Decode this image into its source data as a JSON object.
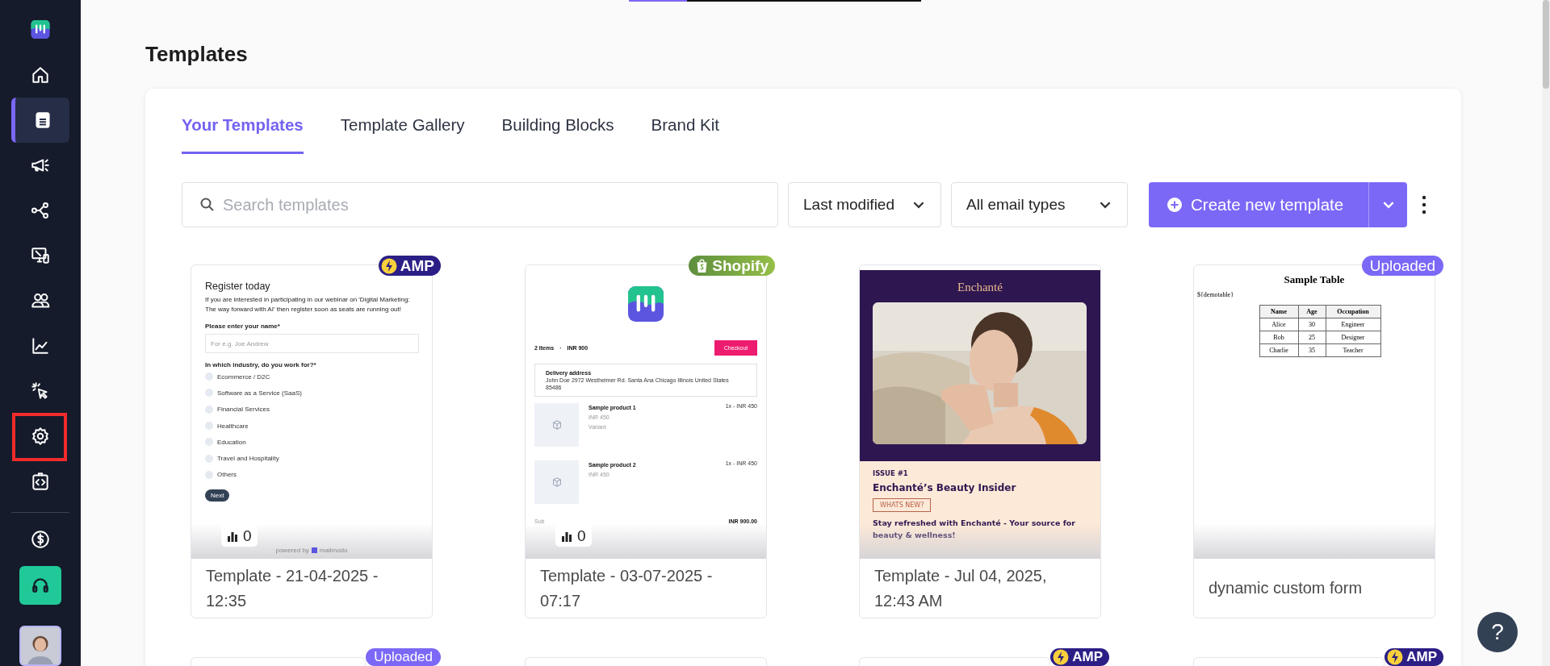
{
  "top_progress": {
    "level": 0.2
  },
  "sidebar": {
    "items": [
      {
        "kind": "home",
        "selected": false,
        "highlighted": false
      },
      {
        "kind": "templates",
        "selected": true,
        "highlighted": false
      },
      {
        "kind": "campaigns",
        "selected": false,
        "highlighted": false
      },
      {
        "kind": "journeys",
        "selected": false,
        "highlighted": false
      },
      {
        "kind": "devices",
        "selected": false,
        "highlighted": false
      },
      {
        "kind": "contacts",
        "selected": false,
        "highlighted": false
      },
      {
        "kind": "analytics",
        "selected": false,
        "highlighted": false
      },
      {
        "kind": "interactions",
        "selected": false,
        "highlighted": false
      },
      {
        "kind": "settings",
        "selected": false,
        "highlighted": true
      },
      {
        "kind": "code",
        "selected": false,
        "highlighted": false
      }
    ],
    "footer_items": [
      {
        "kind": "billing"
      },
      {
        "kind": "support"
      },
      {
        "kind": "profile"
      }
    ]
  },
  "page_title": "Templates",
  "tabs": [
    {
      "label": "Your Templates",
      "selected": true
    },
    {
      "label": "Template Gallery",
      "selected": false
    },
    {
      "label": "Building Blocks",
      "selected": false
    },
    {
      "label": "Brand Kit",
      "selected": false
    }
  ],
  "search": {
    "placeholder": "Search templates"
  },
  "filters": [
    {
      "label": "Last modified"
    },
    {
      "label": "All email types"
    }
  ],
  "create_button": {
    "label": "Create new template"
  },
  "templates": [
    {
      "badge": {
        "kind": "amp",
        "label": "AMP"
      },
      "stats": "0",
      "title": "Template - 21-04-2025 - 12:35",
      "preview": {
        "kind": "amp_form",
        "heading": "Register today",
        "intro": "If you are interested in participating in our webinar on 'Digital Marketing: The way forward with AI' then register soon as seats are running out!",
        "name_label": "Please enter your name*",
        "name_placeholder": "For e.g. Joe Andrew",
        "question": "In which industry, do you work for?*",
        "options": [
          {
            "label": "Ecommerce / D2C",
            "selected": false
          },
          {
            "label": "Software as a Service (SaaS)",
            "selected": false
          },
          {
            "label": "Financial Services",
            "selected": false
          },
          {
            "label": "Healthcare",
            "selected": false
          },
          {
            "label": "Education",
            "selected": false
          },
          {
            "label": "Travel and Hospitality",
            "selected": false
          },
          {
            "label": "Others",
            "selected": false
          }
        ],
        "button": "Next",
        "footer": "powered by",
        "footer_brand": "mailmodo"
      }
    },
    {
      "badge": {
        "kind": "shopify",
        "label": "Shopify"
      },
      "stats": "0",
      "title": "Template - 03-07-2025 - 07:17",
      "preview": {
        "kind": "shopify_cart",
        "count": "2 Items",
        "separator": "·",
        "total": "INR 900",
        "checkout": "Checkout",
        "address_label": "Delivery address",
        "address": "John Doe 2972 Westheimer Rd. Santa Ana Chicago Illinois United States 85486",
        "products": [
          {
            "name": "Sample product 1",
            "price": "INR 450",
            "variant": "Variant",
            "quantity": "1x - INR 450"
          },
          {
            "name": "Sample product 2",
            "price": "INR 450",
            "quantity": "1x - INR 450"
          }
        ],
        "subtotal_label": "Sub",
        "subtotal": "INR 900.00"
      }
    },
    {
      "title": "Template - Jul 04, 2025, 12:43 AM",
      "preview": {
        "kind": "newsletter",
        "brand": "Enchanté",
        "issue": "ISSUE #1",
        "headline": "Enchanté’s Beauty Insider",
        "button": "WHATS NEW?",
        "text": "Stay refreshed with Enchanté - Your source for beauty & wellness!"
      }
    },
    {
      "badge": {
        "kind": "uploaded",
        "label": "Uploaded"
      },
      "title": "dynamic custom form",
      "preview": {
        "kind": "table_doc",
        "heading": "Sample Table",
        "placeholder_text": "${demotable}",
        "columns": [
          "Name",
          "Age",
          "Occupation"
        ],
        "rows": [
          [
            "Alice",
            "30",
            "Engineer"
          ],
          [
            "Bob",
            "25",
            "Designer"
          ],
          [
            "Charlie",
            "35",
            "Teacher"
          ]
        ]
      }
    }
  ],
  "more_templates": [
    {
      "kind": "template",
      "badge": {
        "kind": "uploaded",
        "label": "Uploaded"
      }
    },
    {
      "kind": "template"
    },
    {
      "kind": "template",
      "badge": {
        "kind": "amp",
        "label": "AMP"
      }
    },
    {
      "kind": "template",
      "badge": {
        "kind": "amp",
        "label": "AMP"
      }
    }
  ],
  "help_button": {
    "label": "?"
  }
}
